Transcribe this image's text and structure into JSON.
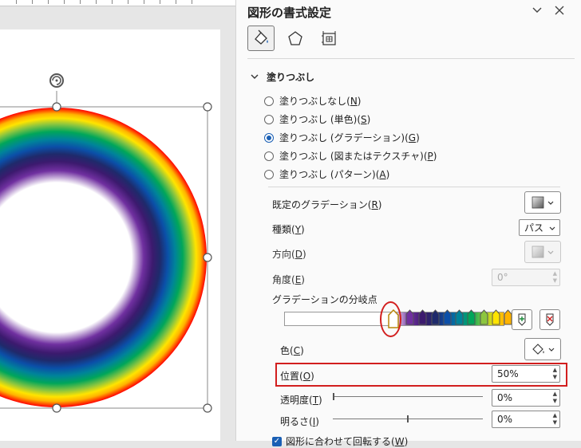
{
  "pane": {
    "title": "図形の書式設定",
    "section_title": "塗りつぶし",
    "fill_options": [
      {
        "label": "塗りつぶしなし",
        "key": "N",
        "checked": false
      },
      {
        "label": "塗りつぶし (単色)",
        "key": "S",
        "checked": false
      },
      {
        "label": "塗りつぶし (グラデーション)",
        "key": "G",
        "checked": true
      },
      {
        "label": "塗りつぶし (図またはテクスチャ)",
        "key": "P",
        "checked": false
      },
      {
        "label": "塗りつぶし (パターン)",
        "key": "A",
        "checked": false
      }
    ],
    "preset_label": "既定のグラデーション",
    "preset_key": "R",
    "type_label": "種類",
    "type_key": "Y",
    "type_value": "パス",
    "direction_label": "方向",
    "direction_key": "D",
    "angle_label": "角度",
    "angle_key": "E",
    "angle_value": "0°",
    "stops_label": "グラデーションの分岐点",
    "color_label": "色",
    "color_key": "C",
    "position_label": "位置",
    "position_key": "O",
    "position_value": "50%",
    "transparency_label": "透明度",
    "transparency_key": "T",
    "transparency_value": "0%",
    "brightness_label": "明るさ",
    "brightness_key": "I",
    "brightness_value": "0%",
    "rotate_label": "図形に合わせて回転する",
    "rotate_key": "W"
  },
  "gradient_stops": [
    {
      "color": "#ffffff",
      "selected": true
    },
    {
      "color": "#7030a0",
      "selected": false
    },
    {
      "color": "#3c1a6e",
      "selected": false
    },
    {
      "color": "#1f2a6b",
      "selected": false
    },
    {
      "color": "#0b4fa8",
      "selected": false
    },
    {
      "color": "#00839a",
      "selected": false
    },
    {
      "color": "#00a65a",
      "selected": false
    },
    {
      "color": "#8cc63f",
      "selected": false
    },
    {
      "color": "#ffe400",
      "selected": false
    },
    {
      "color": "#ffb300",
      "selected": false
    },
    {
      "color": "#ff0000",
      "selected": false
    }
  ],
  "colors": {
    "accent": "#1a5fb4",
    "highlight": "#d21e1e"
  }
}
